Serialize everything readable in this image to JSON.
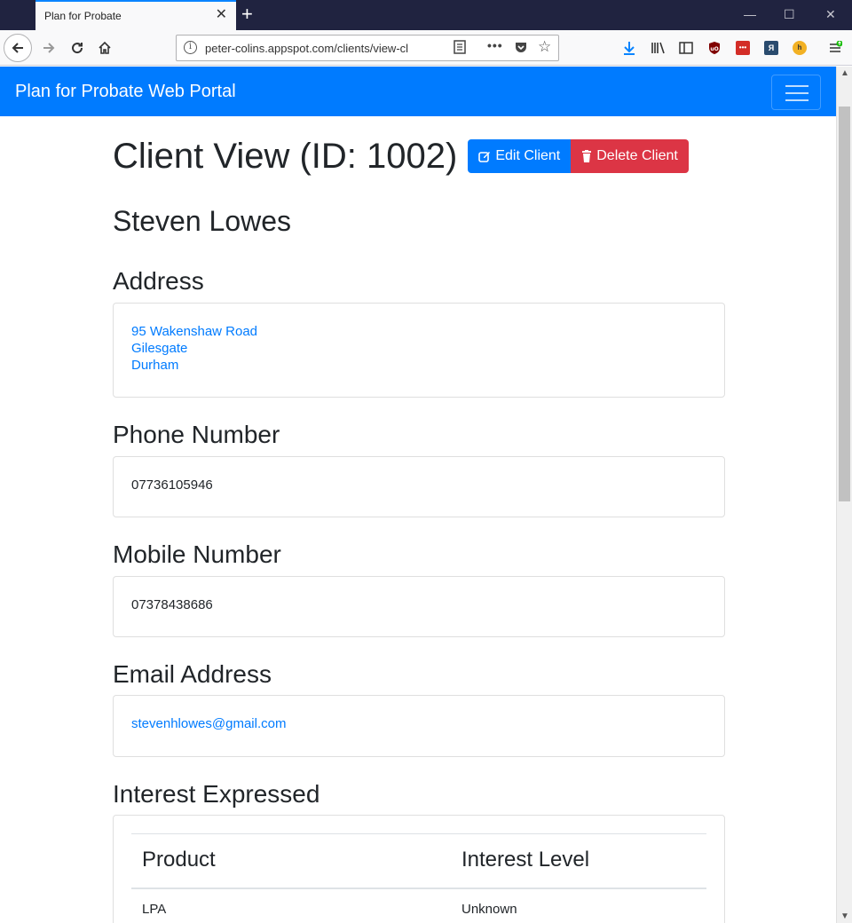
{
  "browser": {
    "tab_title": "Plan for Probate",
    "tab_close": "✕",
    "new_tab": "+",
    "url": "peter-colins.appspot.com/clients/view-cl",
    "info_glyph": "i",
    "window_controls": {
      "minimize": "—",
      "maximize": "☐",
      "close": "✕"
    },
    "extensions": [
      {
        "name": "ublock-icon",
        "glyph": "uO",
        "color": "#800000"
      },
      {
        "name": "lastpass-icon",
        "glyph": "•••",
        "color": "#d32d27"
      },
      {
        "name": "yandex-icon",
        "glyph": "Я",
        "color": "#2a4b6e"
      },
      {
        "name": "honey-icon",
        "glyph": "h",
        "color": "#f2b124"
      }
    ]
  },
  "app": {
    "brand": "Plan for Probate Web Portal",
    "page_title": "Client View (ID: 1002)",
    "edit_button": "Edit Client",
    "delete_button": "Delete Client",
    "client_name": "Steven Lowes",
    "sections": {
      "address": {
        "heading": "Address",
        "lines": [
          "95 Wakenshaw Road",
          "Gilesgate",
          "Durham"
        ]
      },
      "phone": {
        "heading": "Phone Number",
        "value": "07736105946"
      },
      "mobile": {
        "heading": "Mobile Number",
        "value": "07378438686"
      },
      "email": {
        "heading": "Email Address",
        "value": "stevenhlowes@gmail.com"
      },
      "interest": {
        "heading": "Interest Expressed",
        "columns": [
          "Product",
          "Interest Level"
        ],
        "rows": [
          [
            "LPA",
            "Unknown"
          ]
        ]
      }
    }
  },
  "colors": {
    "primary": "#007bff",
    "danger": "#dc3545",
    "tabbar": "#202340"
  }
}
